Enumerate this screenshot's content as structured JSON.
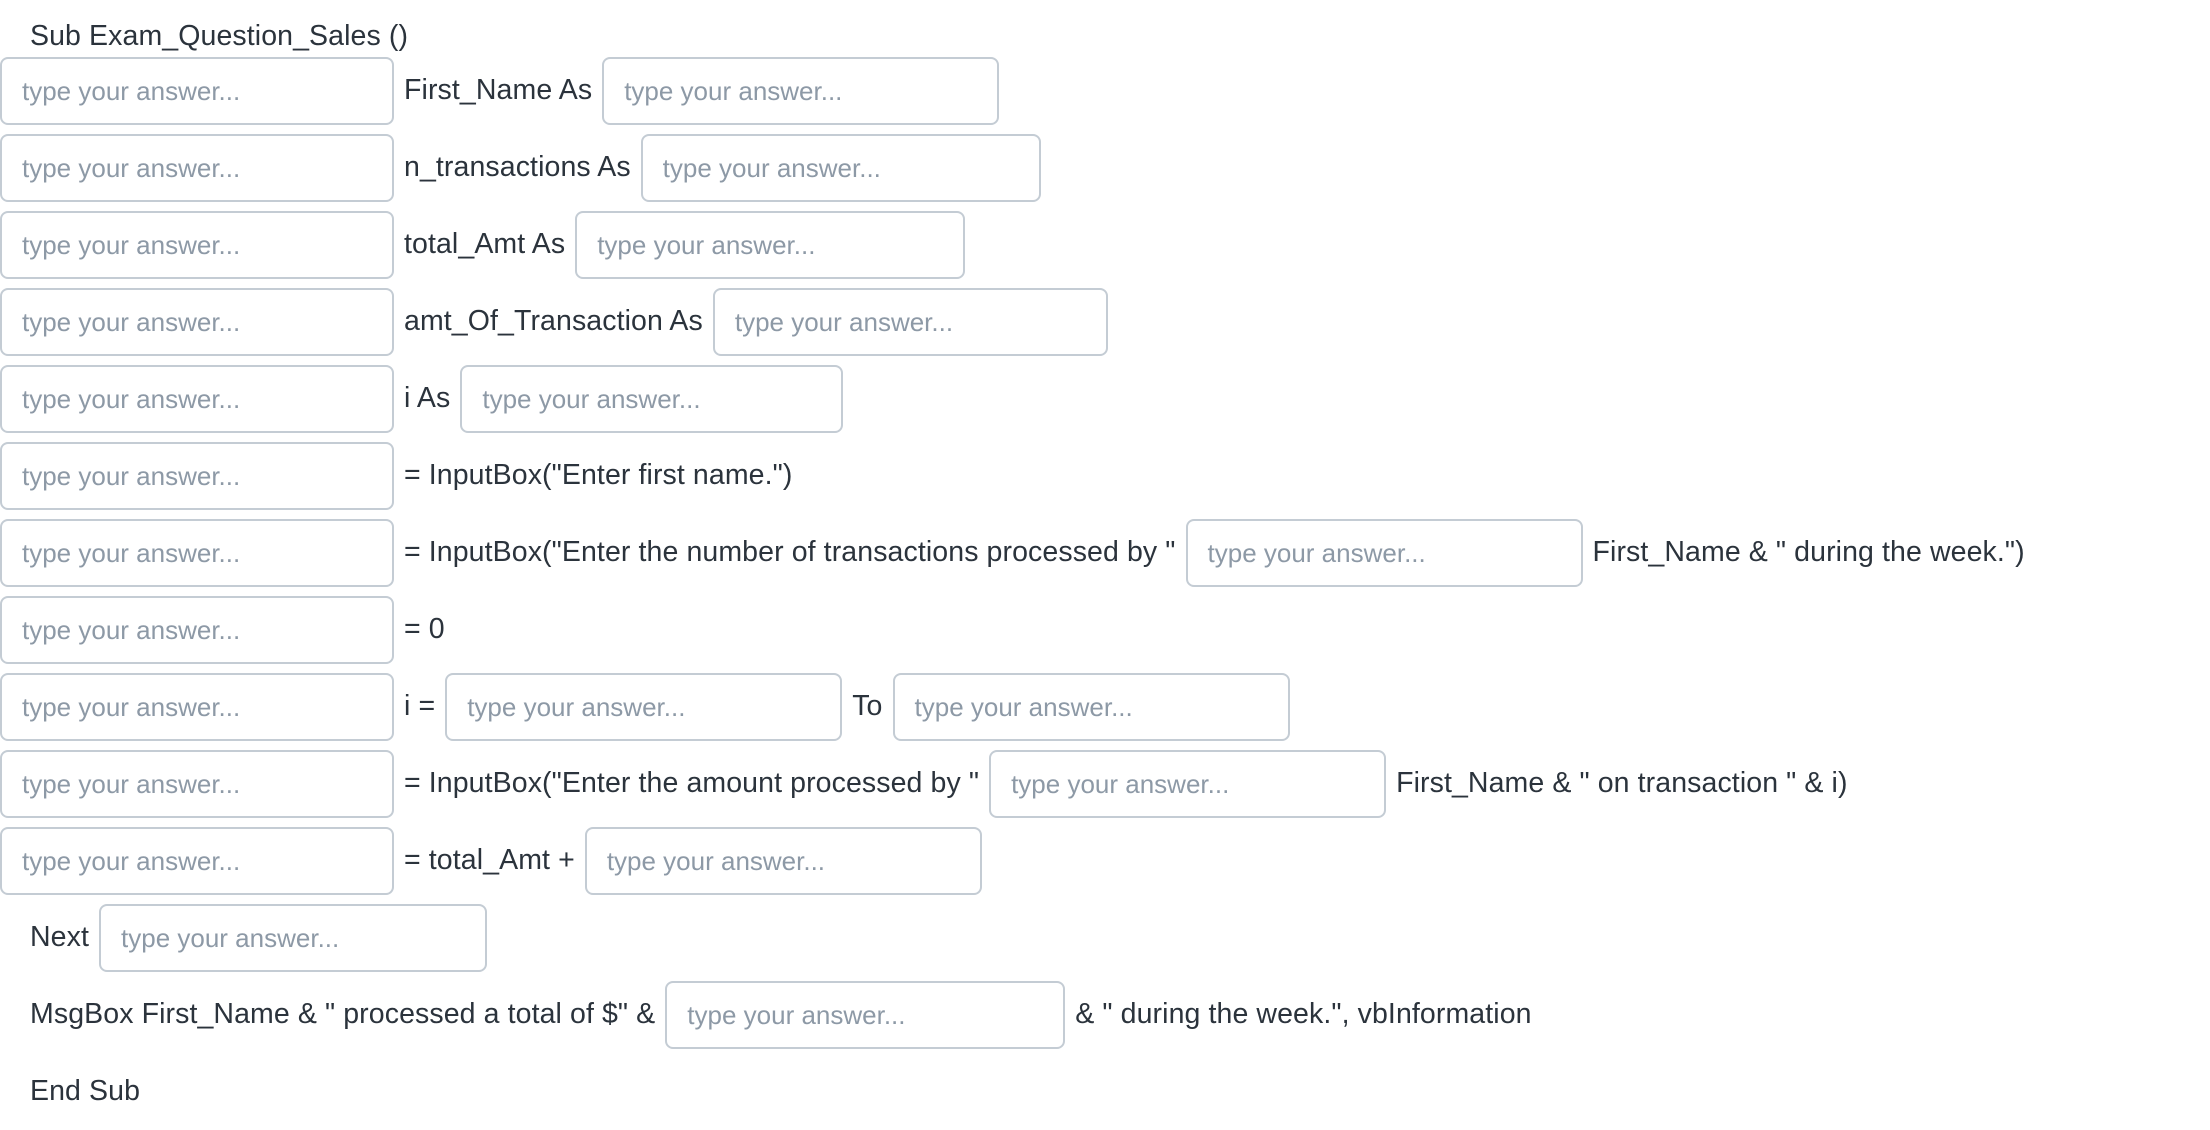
{
  "document": {
    "type": "vba-fill-in-the-blank-exercise",
    "placeholder": "type your answer...",
    "title_line": "Sub Exam_Question_Sales ()",
    "end_line": "End Sub"
  },
  "lines": [
    {
      "id": "line-title",
      "segments": [
        {
          "kind": "text",
          "value": "Sub Exam_Question_Sales ()"
        }
      ]
    },
    {
      "id": "line-dim-first-name",
      "segments": [
        {
          "kind": "blank",
          "name": "blank-dim-keyword-first-name"
        },
        {
          "kind": "text",
          "value": "First_Name As"
        },
        {
          "kind": "blank",
          "name": "blank-type-first-name"
        }
      ]
    },
    {
      "id": "line-dim-n-transactions",
      "segments": [
        {
          "kind": "blank",
          "name": "blank-dim-keyword-n-transactions"
        },
        {
          "kind": "text",
          "value": "n_transactions As"
        },
        {
          "kind": "blank",
          "name": "blank-type-n-transactions"
        }
      ]
    },
    {
      "id": "line-dim-total-amt",
      "segments": [
        {
          "kind": "blank",
          "name": "blank-dim-keyword-total-amt"
        },
        {
          "kind": "text",
          "value": "total_Amt As"
        },
        {
          "kind": "blank",
          "name": "blank-type-total-amt"
        }
      ]
    },
    {
      "id": "line-dim-amt-of-transaction",
      "segments": [
        {
          "kind": "blank",
          "name": "blank-dim-keyword-amt-of-transaction"
        },
        {
          "kind": "text",
          "value": "amt_Of_Transaction As"
        },
        {
          "kind": "blank",
          "name": "blank-type-amt-of-transaction"
        }
      ]
    },
    {
      "id": "line-dim-i",
      "segments": [
        {
          "kind": "blank",
          "name": "blank-dim-keyword-i"
        },
        {
          "kind": "text",
          "value": "i As"
        },
        {
          "kind": "blank",
          "name": "blank-type-i"
        }
      ]
    },
    {
      "id": "line-inputbox-first-name",
      "segments": [
        {
          "kind": "blank",
          "name": "blank-assign-first-name"
        },
        {
          "kind": "text",
          "value": "= InputBox(\"Enter first name.\")"
        }
      ]
    },
    {
      "id": "line-inputbox-n-transactions",
      "segments": [
        {
          "kind": "blank",
          "name": "blank-assign-n-transactions"
        },
        {
          "kind": "text",
          "value": "= InputBox(\"Enter the number of transactions processed by \""
        },
        {
          "kind": "blank",
          "name": "blank-concat-operator-n-transactions"
        },
        {
          "kind": "text",
          "value": "First_Name & \" during the week.\")"
        }
      ]
    },
    {
      "id": "line-init-total",
      "segments": [
        {
          "kind": "blank",
          "name": "blank-init-total-amt"
        },
        {
          "kind": "text",
          "value": "= 0"
        }
      ]
    },
    {
      "id": "line-for-loop",
      "segments": [
        {
          "kind": "blank",
          "name": "blank-for-keyword"
        },
        {
          "kind": "text",
          "value": "i ="
        },
        {
          "kind": "blank",
          "name": "blank-loop-start"
        },
        {
          "kind": "text",
          "value": "To"
        },
        {
          "kind": "blank",
          "name": "blank-loop-end"
        }
      ]
    },
    {
      "id": "line-inputbox-amount",
      "segments": [
        {
          "kind": "blank",
          "name": "blank-assign-amt-of-transaction"
        },
        {
          "kind": "text",
          "value": "= InputBox(\"Enter the amount processed by \""
        },
        {
          "kind": "blank",
          "name": "blank-concat-operator-amount"
        },
        {
          "kind": "text",
          "value": "First_Name & \" on transaction \" & i)"
        }
      ]
    },
    {
      "id": "line-accumulate-total",
      "segments": [
        {
          "kind": "blank",
          "name": "blank-accumulate-target"
        },
        {
          "kind": "text",
          "value": "= total_Amt +"
        },
        {
          "kind": "blank",
          "name": "blank-accumulate-addend"
        }
      ]
    },
    {
      "id": "line-next",
      "segments": [
        {
          "kind": "text",
          "value": "Next"
        },
        {
          "kind": "blank",
          "name": "blank-next-counter"
        }
      ]
    },
    {
      "id": "line-msgbox",
      "segments": [
        {
          "kind": "text",
          "value": "MsgBox First_Name & \" processed a total of $\" &"
        },
        {
          "kind": "blank",
          "name": "blank-msgbox-total"
        },
        {
          "kind": "text",
          "value": "& \" during the week.\", vbInformation"
        }
      ]
    },
    {
      "id": "line-end-sub",
      "segments": [
        {
          "kind": "text",
          "value": "End Sub"
        }
      ]
    }
  ],
  "colors": {
    "text": "#2b333c",
    "placeholder": "#8d99a6",
    "field_border": "#c4ccd4",
    "background": "#ffffff"
  }
}
